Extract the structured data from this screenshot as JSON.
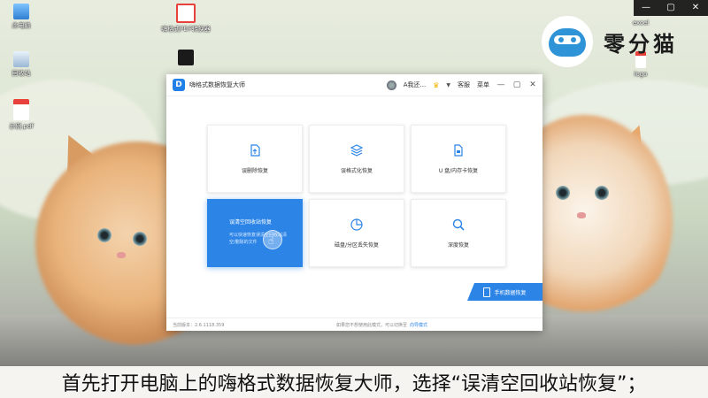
{
  "desktop": {
    "icons": [
      {
        "label": "此电脑",
        "icon": "computer-icon"
      },
      {
        "label": "回收站",
        "icon": "recycle-bin-icon"
      },
      {
        "label": "示例.pdf",
        "icon": "pdf-file-icon"
      },
      {
        "label": "嗨格式PDF转换器",
        "icon": "pdf-converter-icon"
      },
      {
        "label": "excel",
        "icon": "excel-icon"
      },
      {
        "label": "logo",
        "icon": "image-file-icon"
      }
    ],
    "brand_name": "零分猫",
    "top_controls": [
      "—",
      "▢",
      "✕"
    ]
  },
  "app": {
    "title": "嗨格式数据恢复大师",
    "user_name": "A我还...",
    "service": "客服",
    "menu": "菜单",
    "window_controls": [
      "—",
      "▢",
      "✕"
    ],
    "cards": [
      {
        "label": "误删除恢复",
        "icon": "file-restore-icon"
      },
      {
        "label": "误格式化恢复",
        "icon": "layers-icon"
      },
      {
        "label": "U 盘/内存卡恢复",
        "icon": "sd-card-icon"
      },
      {
        "label": "误清空回收站恢复",
        "icon": "recycle-bin-icon",
        "desc": "可以快速恢复误清空回收站清空/删除的文件",
        "active": true
      },
      {
        "label": "磁盘/分区丢失恢复",
        "icon": "pie-chart-icon"
      },
      {
        "label": "深度恢复",
        "icon": "search-icon"
      }
    ],
    "phone_recovery": "手机数据恢复",
    "status": {
      "version": "当前版本：2.6.1118.359",
      "hint": "如果您不想使用此模式，可以切换至",
      "link": "向导模式"
    },
    "accent": "#2b84e6"
  },
  "subtitle": "首先打开电脑上的嗨格式数据恢复大师，选择“误清空回收站恢复”；"
}
